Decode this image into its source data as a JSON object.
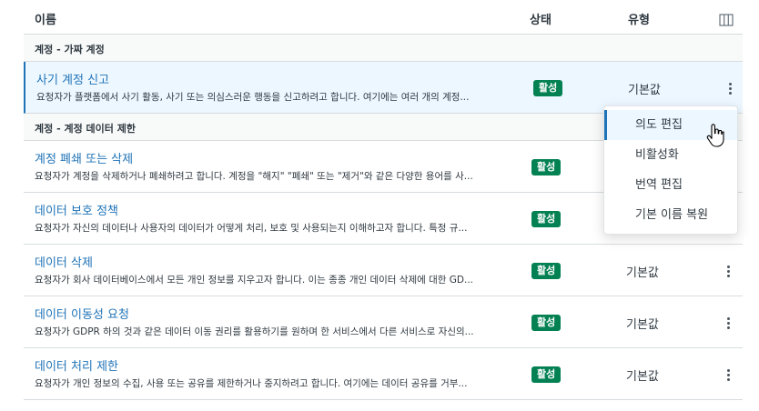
{
  "header": {
    "col_name": "이름",
    "col_status": "상태",
    "col_type": "유형",
    "columns_icon": "columns-icon"
  },
  "groups": [
    {
      "label": "계정 - 가짜 계정",
      "rows": [
        {
          "title": "사기 계정 신고",
          "desc": "요청자가 플랫폼에서 사기 활동, 사기 또는 의심스러운 행동을 신고하려고 합니다. 여기에는 여러 개의 계정...",
          "status": "활성",
          "type": "기본값",
          "selected": true
        }
      ]
    },
    {
      "label": "계정 - 계정 데이터 제한",
      "rows": [
        {
          "title": "계정 폐쇄 또는 삭제",
          "desc": "요청자가 계정을 삭제하거나 폐쇄하려고 합니다. 계정을 \"해지\" \"폐쇄\" 또는 \"제거\"와 같은 다양한 용어를 사...",
          "status": "활성",
          "type": ""
        },
        {
          "title": "데이터 보호 정책",
          "desc": "요청자가 자신의 데이터나 사용자의 데이터가 어떻게 처리, 보호 및 사용되는지 이해하고자 합니다. 특정 규...",
          "status": "활성",
          "type": ""
        },
        {
          "title": "데이터 삭제",
          "desc": "요청자가 회사 데이터베이스에서 모든 개인 정보를 지우고자 합니다. 이는 종종 개인 데이터 삭제에 대한 GD...",
          "status": "활성",
          "type": "기본값"
        },
        {
          "title": "데이터 이동성 요청",
          "desc": "요청자가 GDPR 하의 것과 같은 데이터 이동 권리를 활용하기를 원하며 한 서비스에서 다른 서비스로 자신의...",
          "status": "활성",
          "type": "기본값"
        },
        {
          "title": "데이터 처리 제한",
          "desc": "요청자가 개인 정보의 수집, 사용 또는 공유를 제한하거나 중지하려고 합니다. 여기에는 데이터 공유를 거부...",
          "status": "활성",
          "type": "기본값"
        }
      ]
    }
  ],
  "menu": {
    "items": [
      {
        "label": "의도 편집",
        "active": true
      },
      {
        "label": "비활성화"
      },
      {
        "label": "번역 편집"
      },
      {
        "label": "기본 이름 복원"
      }
    ]
  },
  "colors": {
    "link": "#1f73b7",
    "badge_active": "#038153",
    "selected_row": "#edf7ff"
  }
}
